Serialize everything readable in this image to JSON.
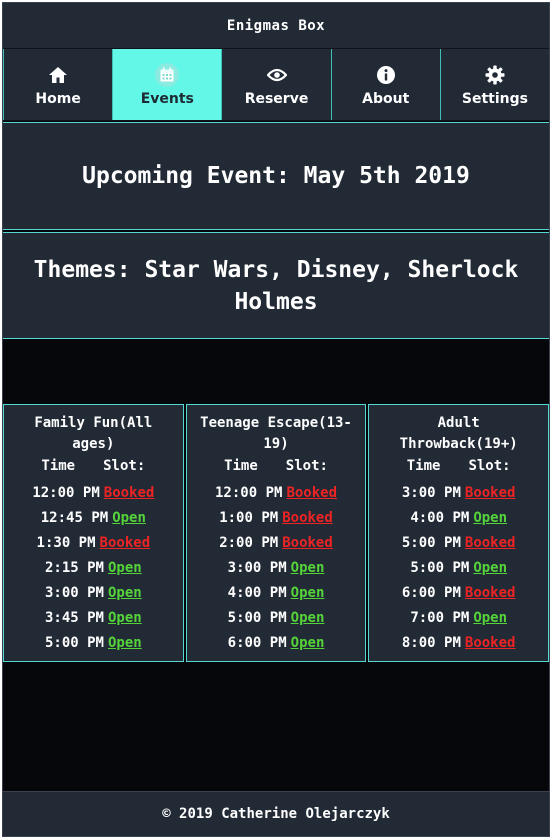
{
  "header": {
    "title": "Enigmas Box"
  },
  "nav": {
    "items": [
      {
        "label": "Home",
        "icon": "home-icon",
        "active": false
      },
      {
        "label": "Events",
        "icon": "calendar-icon",
        "active": true
      },
      {
        "label": "Reserve",
        "icon": "eye-icon",
        "active": false
      },
      {
        "label": "About",
        "icon": "info-icon",
        "active": false
      },
      {
        "label": "Settings",
        "icon": "gear-icon",
        "active": false
      }
    ]
  },
  "event": {
    "heading": "Upcoming Event: May 5th 2019"
  },
  "themes": {
    "heading": "Themes: Star Wars, Disney, Sherlock Holmes"
  },
  "schedule": {
    "time_header": "Time",
    "slot_header": "Slot:",
    "columns": [
      {
        "title": "Family Fun(All ages)",
        "rows": [
          {
            "time": "12:00 PM",
            "status": "Booked"
          },
          {
            "time": "12:45 PM",
            "status": "Open"
          },
          {
            "time": "1:30 PM",
            "status": "Booked"
          },
          {
            "time": "2:15 PM",
            "status": "Open"
          },
          {
            "time": "3:00 PM",
            "status": "Open"
          },
          {
            "time": "3:45 PM",
            "status": "Open"
          },
          {
            "time": "5:00 PM",
            "status": "Open"
          }
        ]
      },
      {
        "title": "Teenage Escape(13-19)",
        "rows": [
          {
            "time": "12:00 PM",
            "status": "Booked"
          },
          {
            "time": "1:00 PM",
            "status": "Booked"
          },
          {
            "time": "2:00 PM",
            "status": "Booked"
          },
          {
            "time": "3:00 PM",
            "status": "Open"
          },
          {
            "time": "4:00 PM",
            "status": "Open"
          },
          {
            "time": "5:00 PM",
            "status": "Open"
          },
          {
            "time": "6:00 PM",
            "status": "Open"
          }
        ]
      },
      {
        "title": "Adult Throwback(19+)",
        "rows": [
          {
            "time": "3:00 PM",
            "status": "Booked"
          },
          {
            "time": "4:00 PM",
            "status": "Open"
          },
          {
            "time": "5:00 PM",
            "status": "Booked"
          },
          {
            "time": "5:00 PM",
            "status": "Open"
          },
          {
            "time": "6:00 PM",
            "status": "Booked"
          },
          {
            "time": "7:00 PM",
            "status": "Open"
          },
          {
            "time": "8:00 PM",
            "status": "Booked"
          }
        ]
      }
    ]
  },
  "colors": {
    "accent": "#63f7e8",
    "panel": "#222a36",
    "booked": "#ee2323",
    "open": "#55d43a"
  },
  "footer": {
    "text": "© 2019 Catherine Olejarczyk"
  }
}
